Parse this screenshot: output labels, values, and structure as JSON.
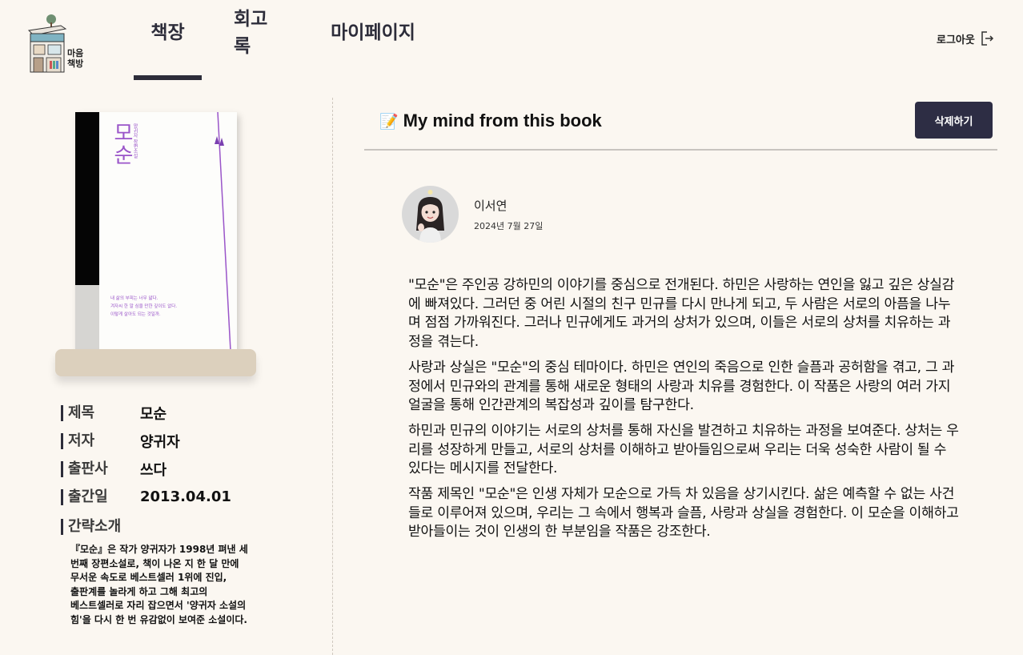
{
  "header": {
    "logo_text": [
      "마음",
      "책방"
    ],
    "tabs": [
      {
        "label": "책장",
        "active": true
      },
      {
        "label": "회고록",
        "active": false
      },
      {
        "label": "마이페이지",
        "active": false
      }
    ],
    "logout_label": "로그아웃"
  },
  "book": {
    "cover_title": "모순",
    "cover_subtitle": "양귀자 장편소설",
    "cover_blurb": [
      "내 삶의 부피는 너무 얇다.",
      "겨자씨 한 알 심을 만한 깊이도 없다.",
      "이렇게 살아도 되는 것일까."
    ],
    "fields": [
      {
        "label": "제목",
        "value": "모순"
      },
      {
        "label": "저자",
        "value": "양귀자"
      },
      {
        "label": "출판사",
        "value": "쓰다"
      },
      {
        "label": "출간일",
        "value": "2013.04.01"
      }
    ],
    "intro_label": "간략소개",
    "intro_text": "『모순』은 작가 양귀자가 1998년 펴낸 세 번째 장편소설로, 책이 나온 지 한 달 만에 무서운 속도로 베스트셀러 1위에 진입, 출판계를 놀라게 하고 그해 최고의 베스트셀러로 자리 잡으면서 '양귀자 소설의 힘'을 다시 한 번 유감없이 보여준 소설이다."
  },
  "review": {
    "section_icon": "📝",
    "section_title": "My mind from this book",
    "delete_label": "삭제하기",
    "author": "이서연",
    "date": "2024년 7월 27일",
    "paragraphs": [
      "\"모순\"은 주인공 강하민의 이야기를 중심으로 전개된다. 하민은 사랑하는 연인을 잃고 깊은 상실감에 빠져있다. 그러던 중 어린 시절의 친구 민규를 다시 만나게 되고, 두 사람은 서로의 아픔을 나누며 점점 가까워진다. 그러나 민규에게도 과거의 상처가 있으며, 이들은 서로의 상처를 치유하는 과정을 겪는다.",
      "사랑과 상실은 \"모순\"의 중심 테마이다. 하민은 연인의 죽음으로 인한 슬픔과 공허함을 겪고, 그 과정에서 민규와의 관계를 통해 새로운 형태의 사랑과 치유를 경험한다. 이 작품은 사랑의 여러 가지 얼굴을 통해 인간관계의 복잡성과 깊이를 탐구한다.",
      "하민과 민규의 이야기는 서로의 상처를 통해 자신을 발견하고 치유하는 과정을 보여준다. 상처는 우리를 성장하게 만들고, 서로의 상처를 이해하고 받아들임으로써 우리는 더욱 성숙한 사람이 될 수 있다는 메시지를 전달한다.",
      "작품 제목인 \"모순\"은 인생 자체가 모순으로 가득 차 있음을 상기시킨다. 삶은 예측할 수 없는 사건들로 이루어져 있으며, 우리는 그 속에서 행복과 슬픔, 사랑과 상실을 경험한다. 이 모순을 이해하고 받아들이는 것이 인생의 한 부분임을 작품은 강조한다."
    ]
  },
  "colors": {
    "background": "#fbf7f1",
    "accent": "#2d2d3a",
    "delete_button": "#2d2d44",
    "cover_purple": "#9a55c9",
    "stand": "#dcd0bd"
  },
  "icons": {
    "logo": "bookstore-building-icon",
    "logout": "logout-icon",
    "memo": "memo-icon"
  }
}
